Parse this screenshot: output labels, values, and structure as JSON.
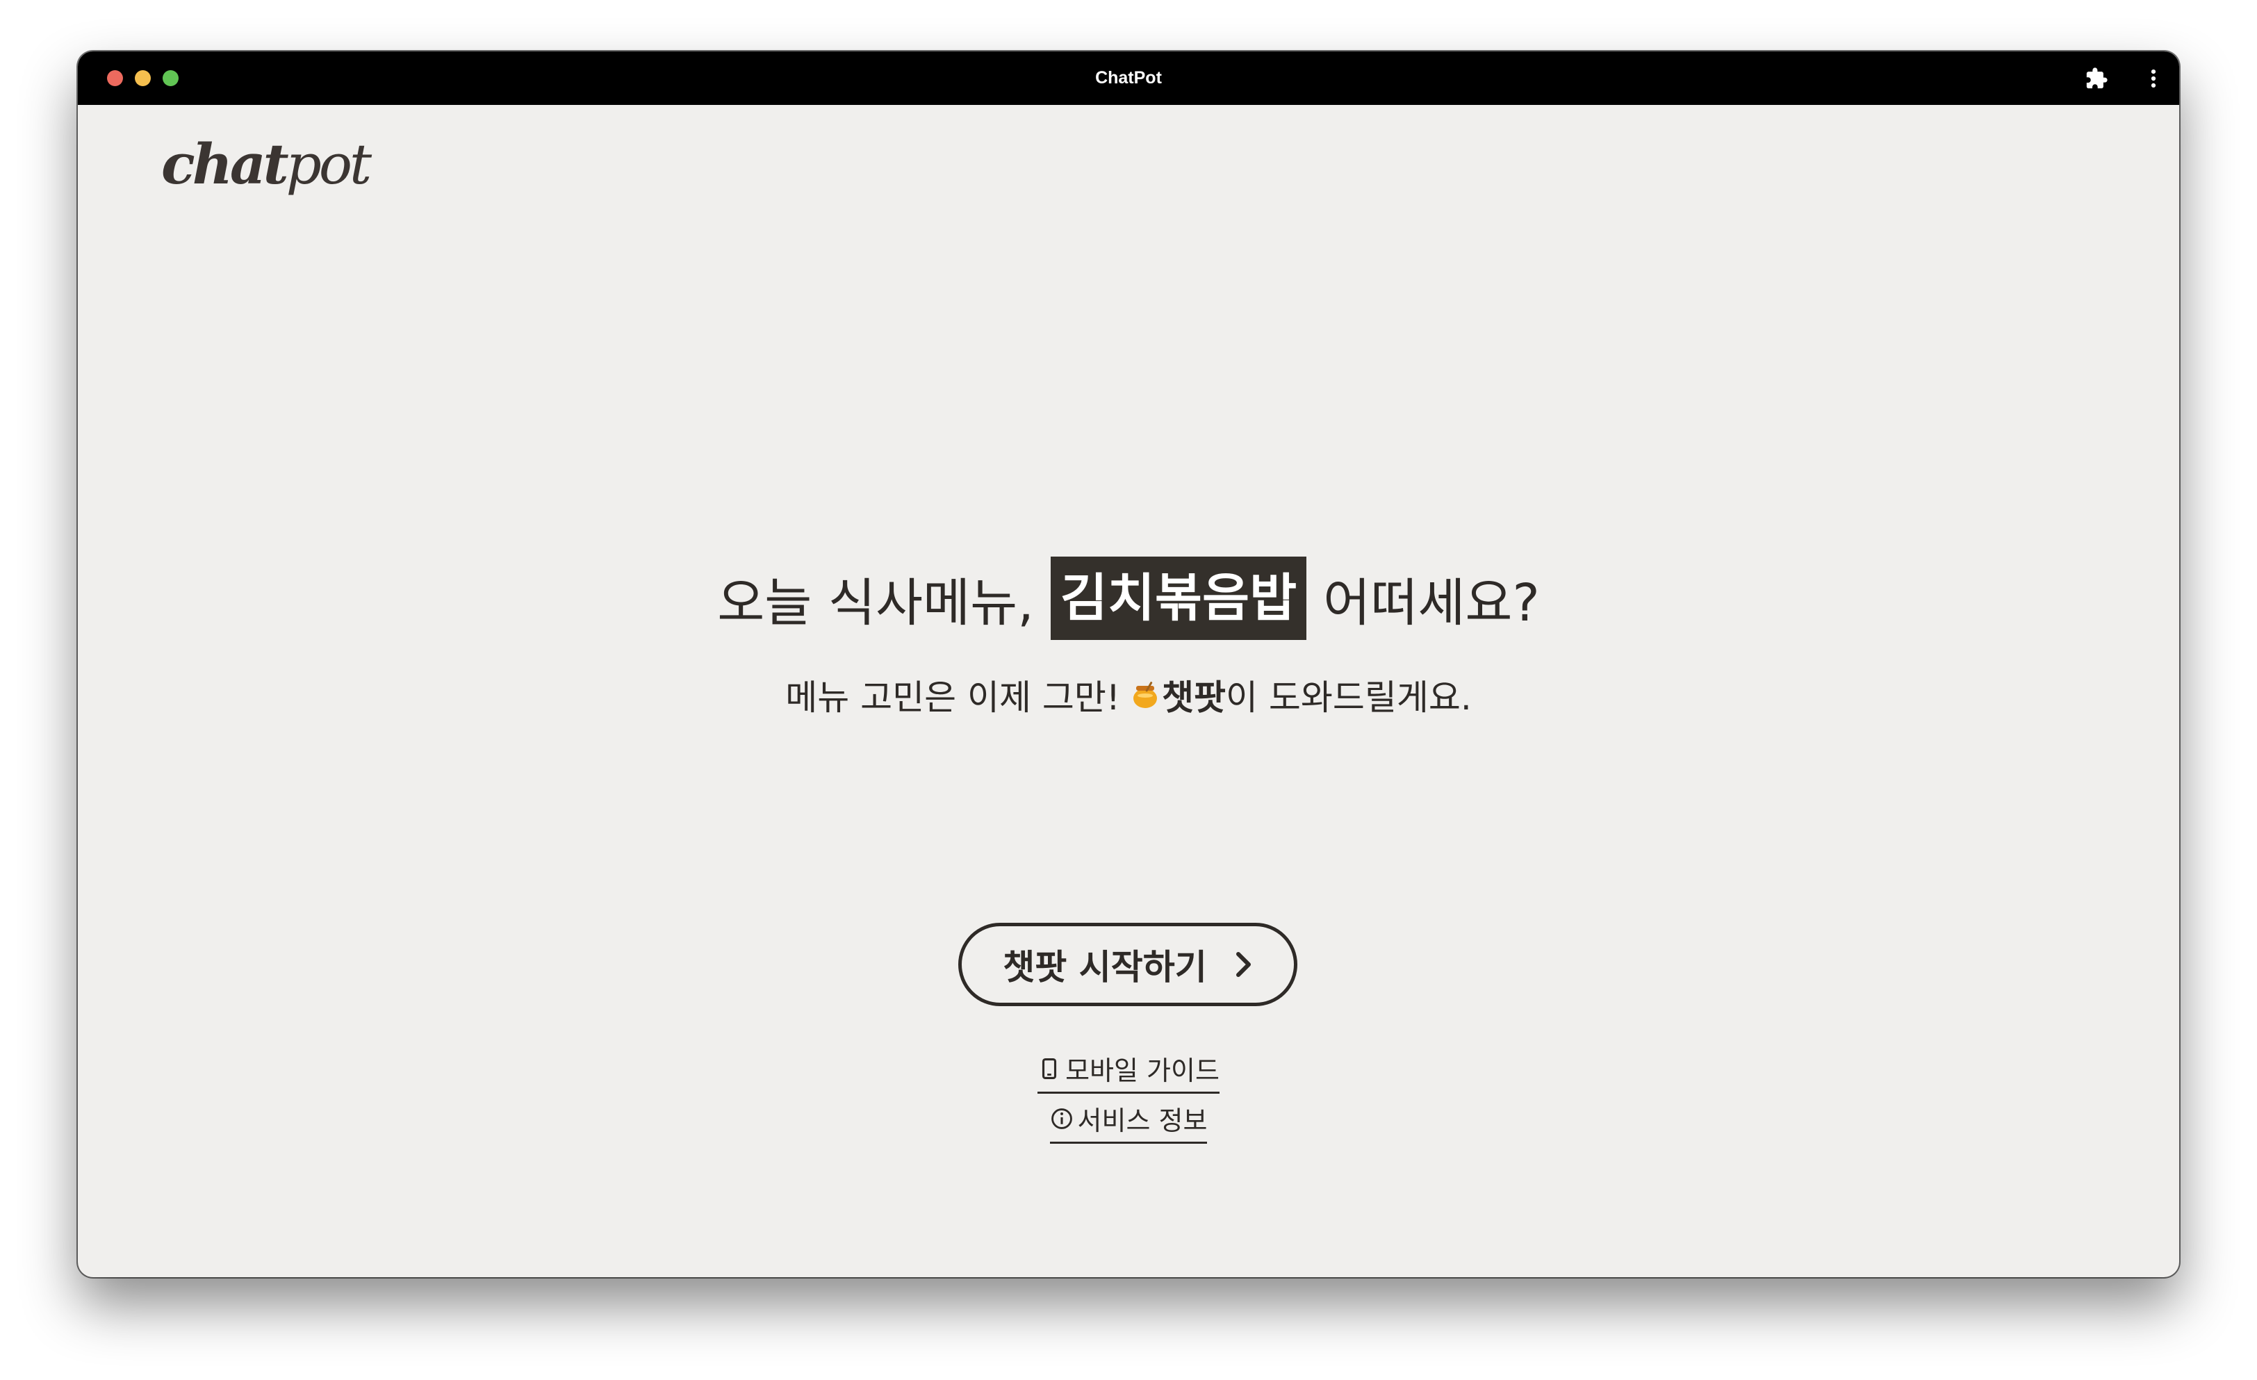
{
  "window": {
    "title": "ChatPot"
  },
  "logo": {
    "bold_part": "chat",
    "light_part": "pot"
  },
  "hero": {
    "headline_before": "오늘 식사메뉴,",
    "headline_highlight": "김치볶음밥",
    "headline_after": "어떠세요?",
    "sub_before": "메뉴 고민은 이제 그만!",
    "sub_icon": "honey-pot-icon",
    "sub_brand": "챗팟",
    "sub_after": "이 도와드릴게요."
  },
  "actions": {
    "start_label": "챗팟 시작하기",
    "mobile_guide_label": "모바일 가이드",
    "service_info_label": "서비스 정보"
  },
  "colors": {
    "background": "#f0efed",
    "text": "#2e2a27",
    "highlight_bg": "#34302b",
    "titlebar": "#000000"
  }
}
